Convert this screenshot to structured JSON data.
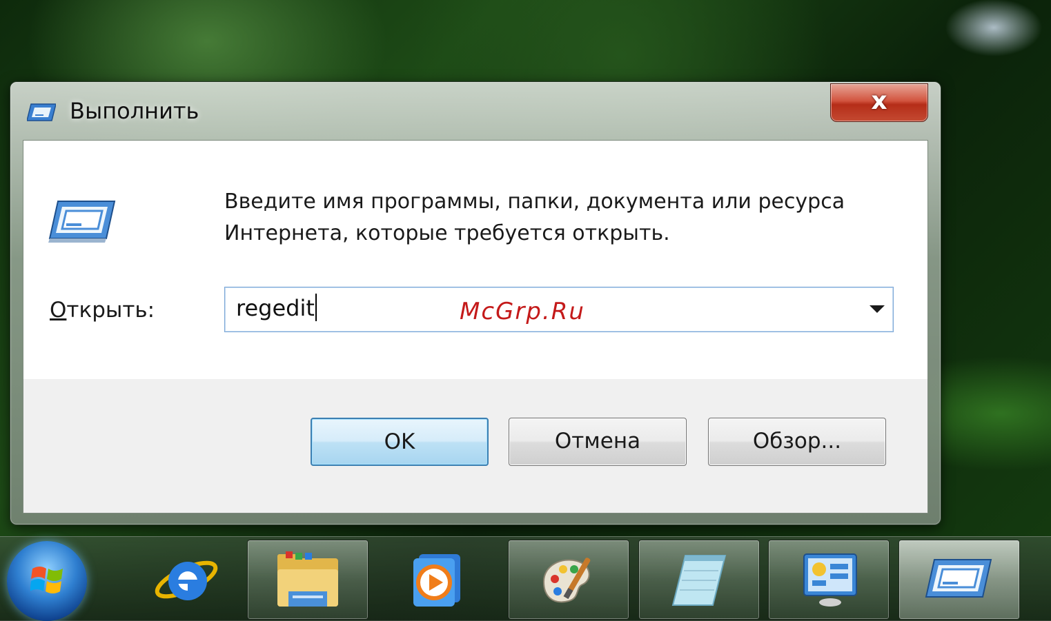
{
  "window": {
    "title": "Выполнить",
    "close_label": "x",
    "description": "Введите имя программы, папки, документа или ресурса Интернета, которые требуется открыть.",
    "open_label_accel": "О",
    "open_label_rest": "ткрыть:",
    "command_value": "regedit"
  },
  "buttons": {
    "ok": "OK",
    "cancel": "Отмена",
    "browse": "Обзор..."
  },
  "watermark": "McGrp.Ru",
  "taskbar": {
    "items": [
      {
        "icon": "windows-start-icon"
      },
      {
        "icon": "internet-explorer-icon"
      },
      {
        "icon": "windows-explorer-icon"
      },
      {
        "icon": "media-player-icon"
      },
      {
        "icon": "paint-icon"
      },
      {
        "icon": "notepad-icon"
      },
      {
        "icon": "control-panel-icon"
      },
      {
        "icon": "run-dialog-icon"
      }
    ]
  },
  "colors": {
    "accent_blue": "#3c7fb1",
    "close_red": "#c44a32",
    "watermark_red": "#c41a1a"
  }
}
